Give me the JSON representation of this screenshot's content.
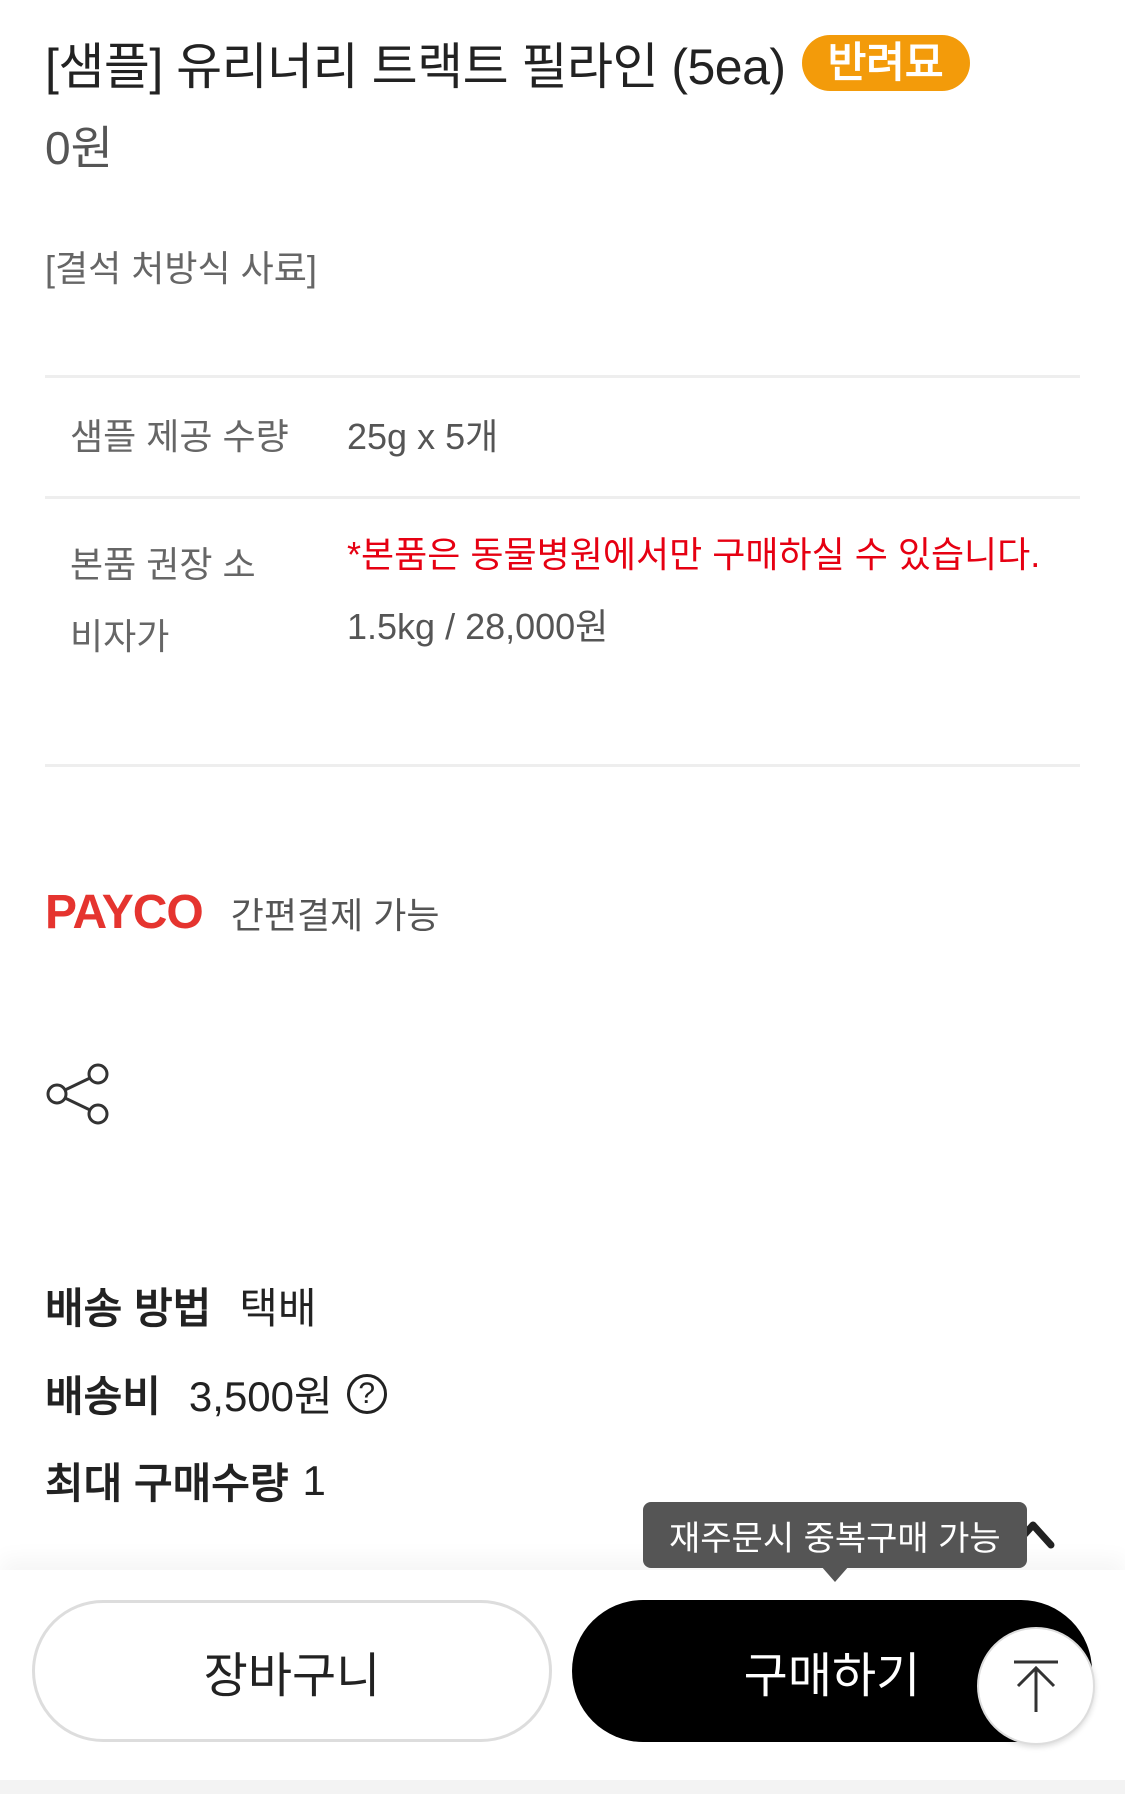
{
  "product": {
    "title": "[샘플] 유리너리 트랙트 필라인 (5ea)",
    "badge": "반려묘",
    "price": "0원",
    "category": "[결석 처방식 사료]"
  },
  "info": {
    "rows": [
      {
        "label": "샘플 제공 수량",
        "value": "25g x 5개"
      },
      {
        "label": "본품 권장 소비자가",
        "notice": "*본품은 동물병원에서만 구매하실 수 있습니다.",
        "value": "1.5kg / 28,000원"
      }
    ]
  },
  "payco": {
    "logo": "PAYCO",
    "text": "간편결제 가능"
  },
  "share": {
    "icon": "share-icon"
  },
  "shipping": {
    "method_label": "배송 방법",
    "method_value": "택배",
    "fee_label": "배송비",
    "fee_value": "3,500원",
    "fee_help": "?",
    "max_label": "최대 구매수량",
    "max_value": "1"
  },
  "footer": {
    "cart_label": "장바구니",
    "buy_label": "구매하기",
    "tooltip": "재주문시 중복구매 가능"
  },
  "colors": {
    "badge": "#f39b0a",
    "notice": "#e60012",
    "payco": "#e5342f",
    "buy": "#000000"
  }
}
